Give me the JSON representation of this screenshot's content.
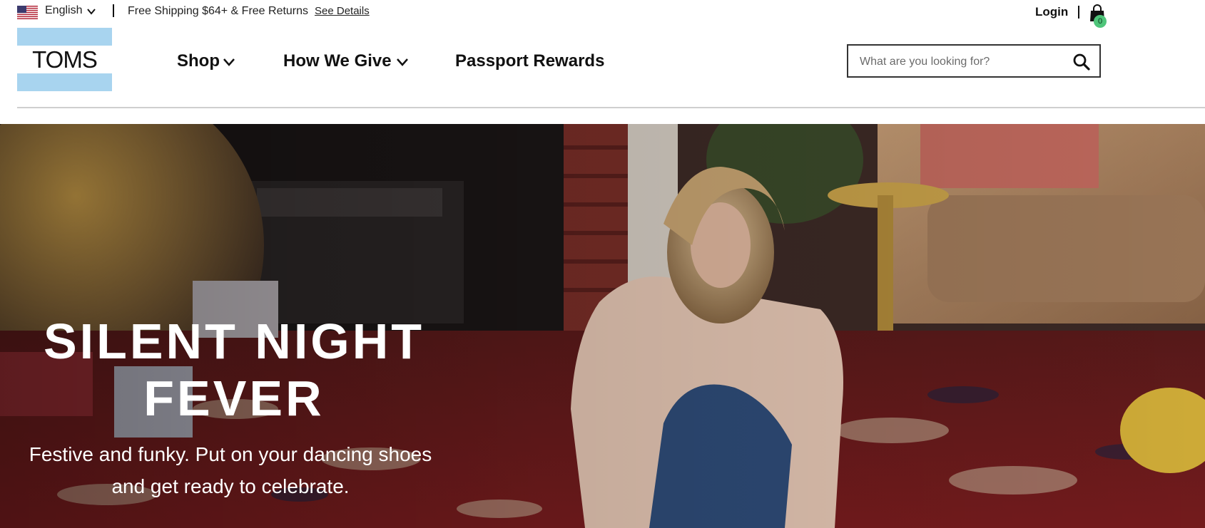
{
  "utility": {
    "language": "English",
    "shipping_text": "Free Shipping $64+ & Free Returns",
    "see_details": "See Details",
    "login": "Login",
    "cart_count": "0",
    "icons": [
      "us-flag-icon",
      "chevron-down-icon",
      "shopping-bag-icon"
    ]
  },
  "header": {
    "logo_text": "TOMS",
    "nav": {
      "shop": "Shop",
      "how_we_give": "How We Give",
      "passport_rewards": "Passport Rewards"
    },
    "search": {
      "placeholder": "What are you looking for?",
      "icon": "search-icon"
    }
  },
  "hero": {
    "title_line1": "SILENT NIGHT",
    "title_line2": "FEVER",
    "subtitle_line1": "Festive and funky. Put on your dancing shoes",
    "subtitle_line2": "and get ready to celebrate."
  },
  "colors": {
    "logo_blue": "#a8d4ef",
    "cart_badge": "#4fc57a",
    "text": "#111111",
    "hero_text": "#ffffff"
  }
}
